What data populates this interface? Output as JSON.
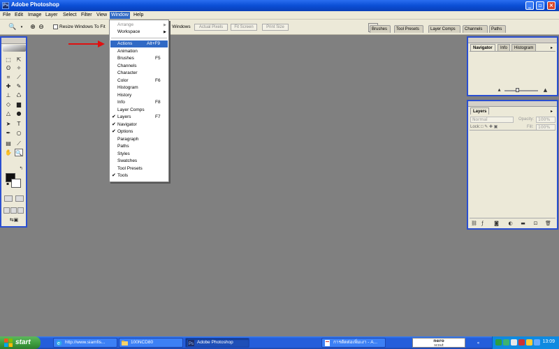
{
  "window": {
    "title": "Adobe Photoshop",
    "app_icon_text": "Ps"
  },
  "menubar": {
    "items": [
      "File",
      "Edit",
      "Image",
      "Layer",
      "Select",
      "Filter",
      "View",
      "Window",
      "Help"
    ],
    "active": "Window"
  },
  "options_bar": {
    "resize_label": "Resize Windows To Fit",
    "windows_label": "l Windows",
    "actual_pixels": "Actual Pixels",
    "fit_screen": "Fit Screen",
    "print_size": "Print Size"
  },
  "palette_well": {
    "tabs": [
      "Brushes",
      "Tool Presets",
      "Layer Comps",
      "Channels",
      "Paths"
    ]
  },
  "window_menu": {
    "items": [
      {
        "label": "Arrange",
        "shortcut": "",
        "checked": false,
        "submenu": true,
        "disabled": true
      },
      {
        "label": "Workspace",
        "shortcut": "",
        "checked": false,
        "submenu": true,
        "disabled": false
      },
      {
        "label": "Actions",
        "shortcut": "Alt+F9",
        "checked": false,
        "submenu": false,
        "highlighted": true
      },
      {
        "label": "Animation",
        "shortcut": "",
        "checked": false
      },
      {
        "label": "Brushes",
        "shortcut": "F5",
        "checked": false
      },
      {
        "label": "Channels",
        "shortcut": "",
        "checked": false
      },
      {
        "label": "Character",
        "shortcut": "",
        "checked": false
      },
      {
        "label": "Color",
        "shortcut": "F6",
        "checked": false
      },
      {
        "label": "Histogram",
        "shortcut": "",
        "checked": false
      },
      {
        "label": "History",
        "shortcut": "",
        "checked": false
      },
      {
        "label": "Info",
        "shortcut": "F8",
        "checked": false
      },
      {
        "label": "Layer Comps",
        "shortcut": "",
        "checked": false
      },
      {
        "label": "Layers",
        "shortcut": "F7",
        "checked": true
      },
      {
        "label": "Navigator",
        "shortcut": "",
        "checked": true
      },
      {
        "label": "Options",
        "shortcut": "",
        "checked": true
      },
      {
        "label": "Paragraph",
        "shortcut": "",
        "checked": false
      },
      {
        "label": "Paths",
        "shortcut": "",
        "checked": false
      },
      {
        "label": "Styles",
        "shortcut": "",
        "checked": false
      },
      {
        "label": "Swatches",
        "shortcut": "",
        "checked": false
      },
      {
        "label": "Tool Presets",
        "shortcut": "",
        "checked": false
      },
      {
        "label": "Tools",
        "shortcut": "",
        "checked": true
      }
    ]
  },
  "navigator_panel": {
    "tabs": [
      "Navigator",
      "Info",
      "Histogram"
    ],
    "active_tab": "Navigator"
  },
  "layers_panel": {
    "tab": "Layers",
    "blend_mode": "Normal",
    "opacity_label": "Opacity:",
    "opacity_value": "100%",
    "lock_label": "Lock:",
    "fill_label": "Fill:",
    "fill_value": "100%"
  },
  "taskbar": {
    "start_label": "start",
    "tasks": [
      {
        "label": "http://www.siamfis...",
        "active": false
      },
      {
        "label": "100NCD80",
        "active": false
      },
      {
        "label": "Adobe Photoshop",
        "active": true
      },
      {
        "label": "การตัดต่อเพิ่มเงา - A...",
        "active": false
      }
    ],
    "nero_top": "nero",
    "nero_bottom": "scout",
    "clock": "13:09"
  },
  "colors": {
    "titlebar": "#0b4fd6",
    "menu_highlight": "#316ac5",
    "workspace": "#808080",
    "panel_bg": "#ece9d8",
    "taskbar": "#245edb",
    "start_button": "#3c9a3c",
    "annotation_arrow": "#e01010"
  }
}
